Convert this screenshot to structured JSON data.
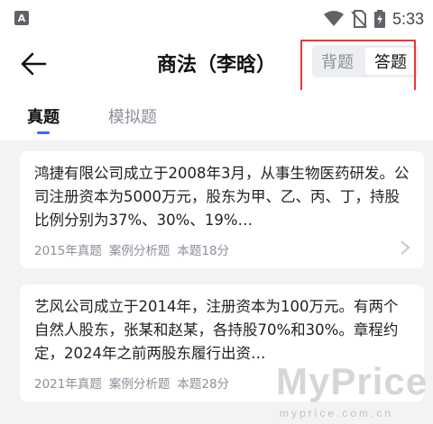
{
  "status_bar": {
    "app_icon_letter": "A",
    "time": "5:33"
  },
  "header": {
    "title": "商法（李晗）"
  },
  "mode_toggle": {
    "options": [
      "背题",
      "答题"
    ],
    "selected": "答题"
  },
  "tabs": [
    {
      "label": "真题",
      "active": true
    },
    {
      "label": "模拟题",
      "active": false
    }
  ],
  "cards": [
    {
      "text": "鸿捷有限公司成立于2008年3月，从事生物医药研发。公司注册资本为5000万元，股东为甲、乙、丙、丁，持股比例分别为37%、30%、19%…",
      "meta": [
        "2015年真题",
        "案例分析题",
        "本题18分"
      ]
    },
    {
      "text": "艺风公司成立于2014年，注册资本为100万元。有两个自然人股东，张某和赵某，各持股70%和30%。章程约定，2024年之前两股东履行出资…",
      "meta": [
        "2021年真题",
        "案例分析题",
        "本题28分"
      ]
    }
  ],
  "watermark": {
    "big": "MyPrice",
    "small": "myprice.com.cn"
  },
  "colors": {
    "accent": "#2f6df6",
    "highlight": "#e53935",
    "muted": "#8a8f99"
  }
}
